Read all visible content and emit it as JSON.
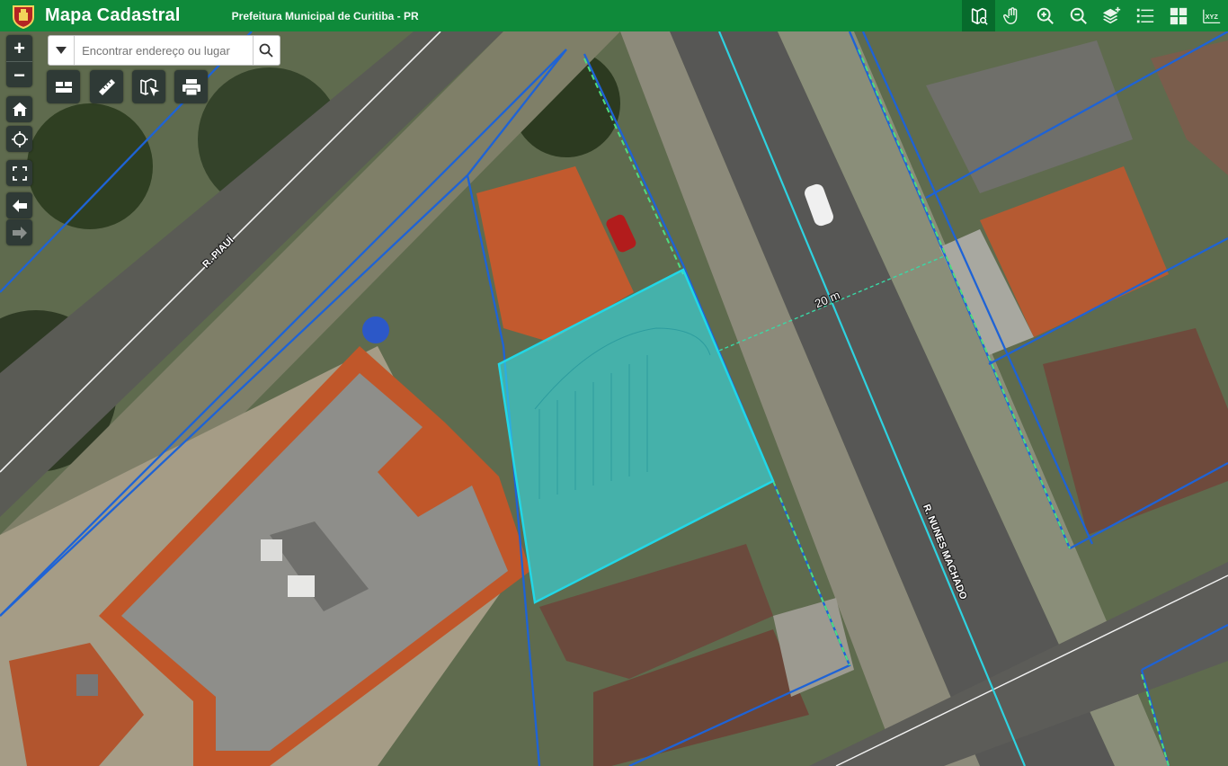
{
  "header": {
    "app_title": "Mapa Cadastral",
    "subtitle": "Prefeitura Municipal de Curitiba - PR",
    "icons": [
      "identify-icon",
      "pan-hand-icon",
      "zoom-in-icon",
      "zoom-out-icon",
      "layers-icon",
      "list-icon",
      "basemap-grid-icon",
      "xyz-icon"
    ],
    "xyz_label": "XYZ"
  },
  "search": {
    "placeholder": "Encontrar endereço ou lugar"
  },
  "controls": {
    "zoom_in": "+",
    "zoom_out": "−"
  },
  "map": {
    "street_labels": [
      "R. PIAUÍ",
      "R. NUNES MACHADO"
    ],
    "measure_label": "20 m",
    "colors": {
      "lot_line": "#1e63d6",
      "selected_fill": "#34e0e8",
      "selected_stroke": "#22d7e6",
      "road_line": "#2fd2e0",
      "header_green": "#0f8a3a"
    }
  }
}
